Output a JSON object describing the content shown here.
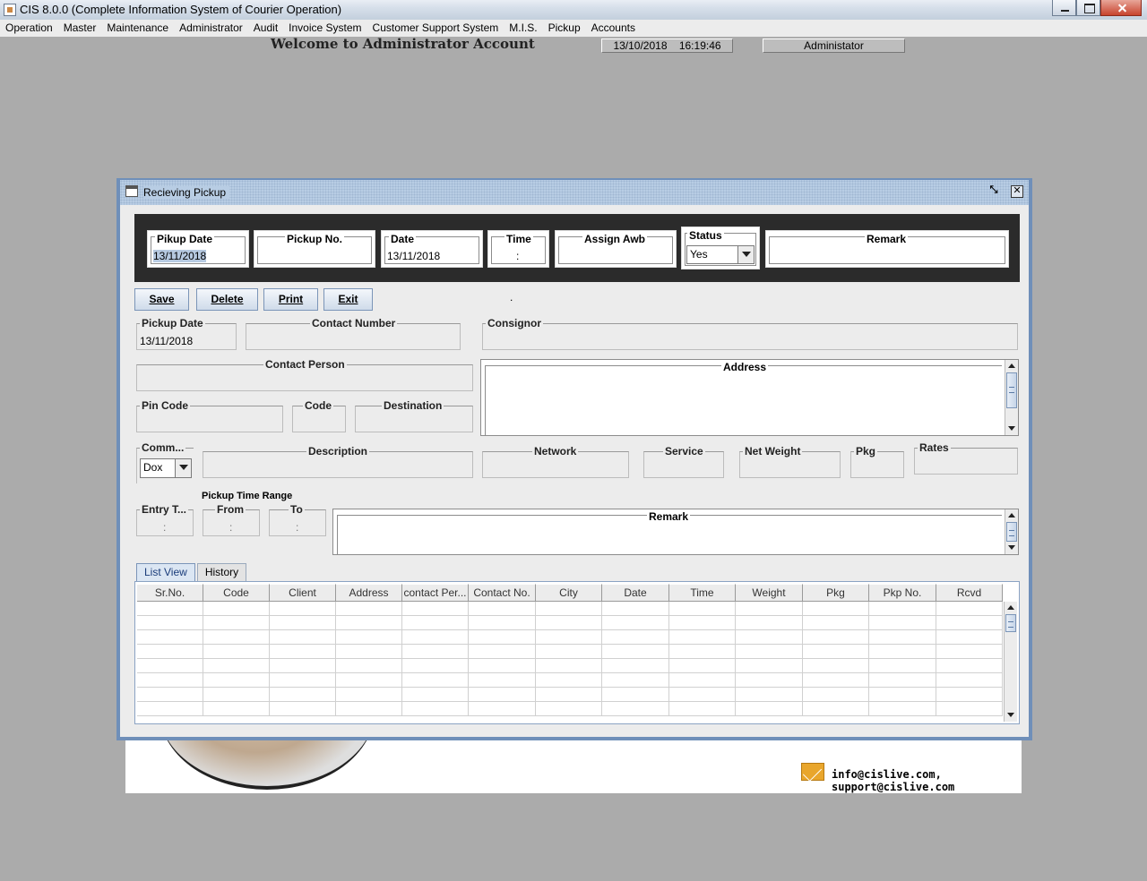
{
  "window": {
    "title": "CIS 8.0.0 (Complete Information System of Courier Operation)"
  },
  "menu": [
    "Operation",
    "Master",
    "Maintenance",
    "Administrator",
    "Audit",
    "Invoice System",
    "Customer Support System",
    "M.I.S.",
    "Pickup",
    "Accounts"
  ],
  "header": {
    "welcome": "Welcome to Administrator Account",
    "datetime": "13/10/2018    16:19:46",
    "user": "Administator"
  },
  "footer": {
    "email": "info@cislive.com, support@cislive.com"
  },
  "dialog": {
    "title": "Recieving Pickup",
    "top": {
      "pikup_date_label": "Pikup Date",
      "pikup_date_value": "13/11/2018",
      "pickup_no_label": "Pickup No.",
      "pickup_no_value": "",
      "date_label": "Date",
      "date_value": "13/11/2018",
      "time_label": "Time",
      "time_value": ":",
      "assign_awb_label": "Assign Awb",
      "status_label": "Status",
      "status_value": "Yes",
      "remark_label": "Remark"
    },
    "buttons": {
      "save": "Save",
      "delete": "Delete",
      "print": "Print",
      "exit": "Exit",
      "dot": "."
    },
    "form": {
      "pickup_date_label": "Pickup Date",
      "pickup_date_value": "13/11/2018",
      "contact_number_label": "Contact Number",
      "consignor_label": "Consignor",
      "contact_person_label": "Contact Person",
      "address_label": "Address",
      "pin_code_label": "Pin Code",
      "code_label": "Code",
      "destination_label": "Destination",
      "comm_label": "Comm...",
      "comm_value": "Dox",
      "description_label": "Description",
      "network_label": "Network",
      "service_label": "Service",
      "net_weight_label": "Net Weight",
      "pkg_label": "Pkg",
      "rates_label": "Rates",
      "pickup_time_range": "Pickup Time Range",
      "entry_time_label": "Entry T...",
      "entry_time_value": ":",
      "from_label": "From",
      "from_value": ":",
      "to_label": "To",
      "to_value": ":",
      "remark_label": "Remark"
    },
    "tabs": [
      "List View",
      "History"
    ],
    "table": {
      "columns": [
        "Sr.No.",
        "Code",
        "Client",
        "Address",
        "contact Per...",
        "Contact No.",
        "City",
        "Date",
        "Time",
        "Weight",
        "Pkg",
        "Pkp No.",
        "Rcvd"
      ]
    }
  }
}
